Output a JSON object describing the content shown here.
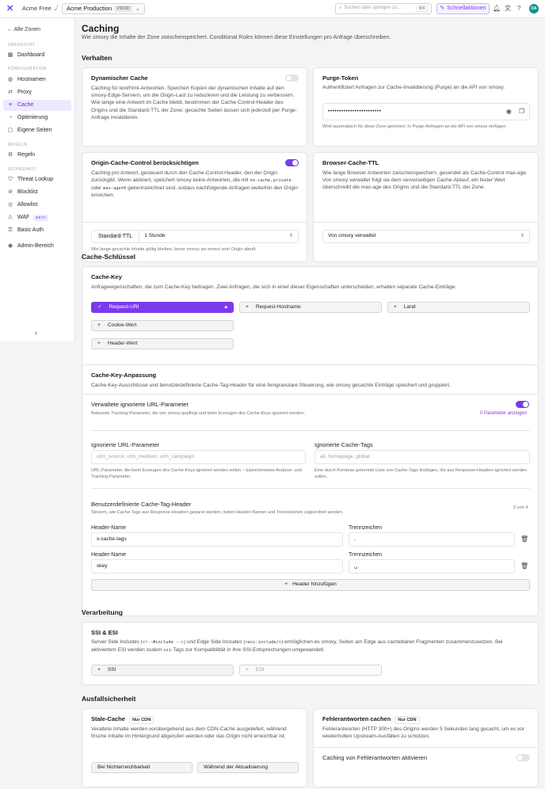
{
  "topbar": {
    "zone": "Acme Free",
    "env": "Acme Production",
    "env_badge": "PROD",
    "search_placeholder": "Suchen oder springen zu...",
    "search_kbd": "⌘K",
    "quick_actions": "Schnellaktionen",
    "avatar": "DA"
  },
  "sidebar": {
    "back": "Alle Zonen",
    "sections": [
      "ÜBERSICHT",
      "KONFIGURATION",
      "REGELN",
      "SICHERHEIT"
    ],
    "items": [
      "Dashboard",
      "Hostnamen",
      "Proxy",
      "Cache",
      "Optimierung",
      "Eigene Seiten",
      "Regeln",
      "Threat Lookup",
      "Blocklist",
      "Allowlist",
      "WAF",
      "Basic Auth",
      "Admin-Bereich"
    ],
    "waf_badge": "BETA"
  },
  "page": {
    "title": "Caching",
    "subtitle": "Wie smoxy die Inhalte der Zone zwischenspeichert. Conditional Rules können diese Einstellungen pro Anfrage überschreiben."
  },
  "sections": {
    "behavior": "Verhalten",
    "cache_key": "Cache-Schlüssel",
    "processing": "Verarbeitung",
    "resilience": "Ausfallsicherheit"
  },
  "dynamic_cache": {
    "title": "Dynamischer Cache",
    "desc": "Caching für text/html-Antworten. Speichert Kopien der dynamischen Inhalte auf den smoxy-Edge-Servern, um die Origin-Last zu reduzieren und die Leistung zu verbessern. Wie lange eine Antwort im Cache bleibt, bestimmen der Cache-Control-Header des Origins und die Standard-TTL der Zone; gecachte Seiten lassen sich jederzeit per Purge-Anfrage invalidieren.",
    "enabled": false
  },
  "purge_token": {
    "title": "Purge-Token",
    "desc": "Authentifiziert Anfragen zur Cache-Invalidierung (Purge) an die API von smoxy.",
    "value": "••••••••••••••••••••••••",
    "hint": "Wird automatisch für diese Zone generiert. In Purge-Anfragen an die API von smoxy einfügen."
  },
  "origin_cc": {
    "title": "Origin-Cache-Control berücksichtigen",
    "desc_1": "Caching pro Antwort, gesteuert durch den Cache-Control-Header, den der Origin zurückgibt. Wenn aktiviert, speichert smoxy keine Antworten, die mit ",
    "code_1": "no-cache",
    "desc_2": ", ",
    "code_2": "private",
    "desc_3": " oder ",
    "code_3": "max-age=0",
    "desc_4": " gekennzeichnet sind, sodass nachfolgende Anfragen weiterhin den Origin erreichen.",
    "enabled": true,
    "ttl_label": "Standard-TTL",
    "ttl_value": "1 Stunde",
    "ttl_hint": "Wie lange gecachte Inhalte gültig bleiben, bevor smoxy sie erneut vom Origin abruft."
  },
  "browser_ttl": {
    "title": "Browser-Cache-TTL",
    "desc": "Wie lange Browser Antworten zwischenspeichern, gesendet als Cache-Control max-age. Von smoxy verwaltet folgt sie dem serverseitigen Cache-Ablauf; ein fester Wert überschreibt die max-age des Origins und die Standard-TTL der Zone.",
    "value": "Von smoxy verwaltet"
  },
  "cache_key_card": {
    "title": "Cache-Key",
    "desc": "Anfrageeigenschaften, die zum Cache-Key beitragen. Zwei Anfragen, die sich in einer dieser Eigenschaften unterscheiden, erhalten separate Cache-Einträge.",
    "chips": [
      "Request-URI",
      "Request-Hostname",
      "Land",
      "Cookie-Wert",
      "Header-Wert"
    ]
  },
  "customization": {
    "title": "Cache-Key-Anpassung",
    "desc": "Cache-Key-Ausschlüsse und benutzerdefinierte Cache-Tag-Header für eine feingranulare Steuerung, wie smoxy gecachte Einträge speichert und gruppiert.",
    "managed_title": "Verwaltete ignorierte URL-Parameter",
    "managed_desc": "Bekannte Tracking-Parameter, die von smoxy gepflegt und beim Erzeugen des Cache-Keys ignoriert werden.",
    "managed_link": "0 Parameter anzeigen",
    "managed_enabled": true,
    "ignored_params_label": "Ignorierte URL-Parameter",
    "ignored_params_placeholder": "utm_source, utm_medium, utm_campaign",
    "ignored_params_hint": "URL-Parameter, die beim Erzeugen des Cache-Keys ignoriert werden sollen – typischerweise Analyse- und Tracking-Parameter.",
    "ignored_tags_label": "Ignorierte Cache-Tags",
    "ignored_tags_placeholder": "all, homepage, global",
    "ignored_tags_hint": "Eine durch Kommas getrennte Liste von Cache-Tags festlegen, die aus Response-Headern ignoriert werden sollen.",
    "tag_header_title": "Benutzerdefinierte Cache-Tag-Header",
    "tag_header_desc": "Steuern, wie Cache-Tags aus Response-Headern geparst werden, indem Header-Namen und Trennzeichen zugeordnet werden.",
    "tag_header_count": "2 von 4",
    "header_name_label": "Header-Name",
    "separator_label": "Trennzeichen",
    "rows": [
      {
        "name": "x-cache-tags",
        "sep": ","
      },
      {
        "name": "xkey",
        "sep": "␣"
      }
    ],
    "add_header": "Header hinzufügen"
  },
  "ssi": {
    "title": "SSI & ESI",
    "desc_1": "Server Side Includes (",
    "code_1": "<!--#include -->",
    "desc_2": ") und Edge Side Includes (",
    "code_2": "<esi:include/>",
    "desc_3": ") ermöglichen es smoxy, Seiten am Edge aus cachebaren Fragmenten zusammenzusetzen. Bei aktiviertem ESI werden zudem ",
    "code_3": "ssi",
    "desc_4": "-Tags zur Kompatibilität in ihre SSI-Entsprechungen umgewandelt.",
    "chips": [
      "SSI",
      "ESI"
    ]
  },
  "stale": {
    "title": "Stale-Cache",
    "badge": "Nur CDN",
    "desc": "Veraltete Inhalte werden vorübergehend aus dem CDN-Cache ausgeliefert, während frische Inhalte im Hintergrund abgerufen werden oder das Origin nicht erreichbar ist.",
    "opt_1": "Bei Nichterreichbarkeit",
    "opt_2": "Während der Aktualisierung"
  },
  "errors": {
    "title": "Fehlerantworten cachen",
    "badge": "Nur CDN",
    "desc": "Fehlerantworten (HTTP 300+) des Origins werden 5 Sekunden lang gecacht, um es vor wiederholten Upstream-Ausfällen zu schützen.",
    "toggle_label": "Caching von Fehlerantworten aktivieren",
    "enabled": false
  },
  "colors": {
    "accent": "#7c3aed",
    "background": "#f4f4f5"
  }
}
